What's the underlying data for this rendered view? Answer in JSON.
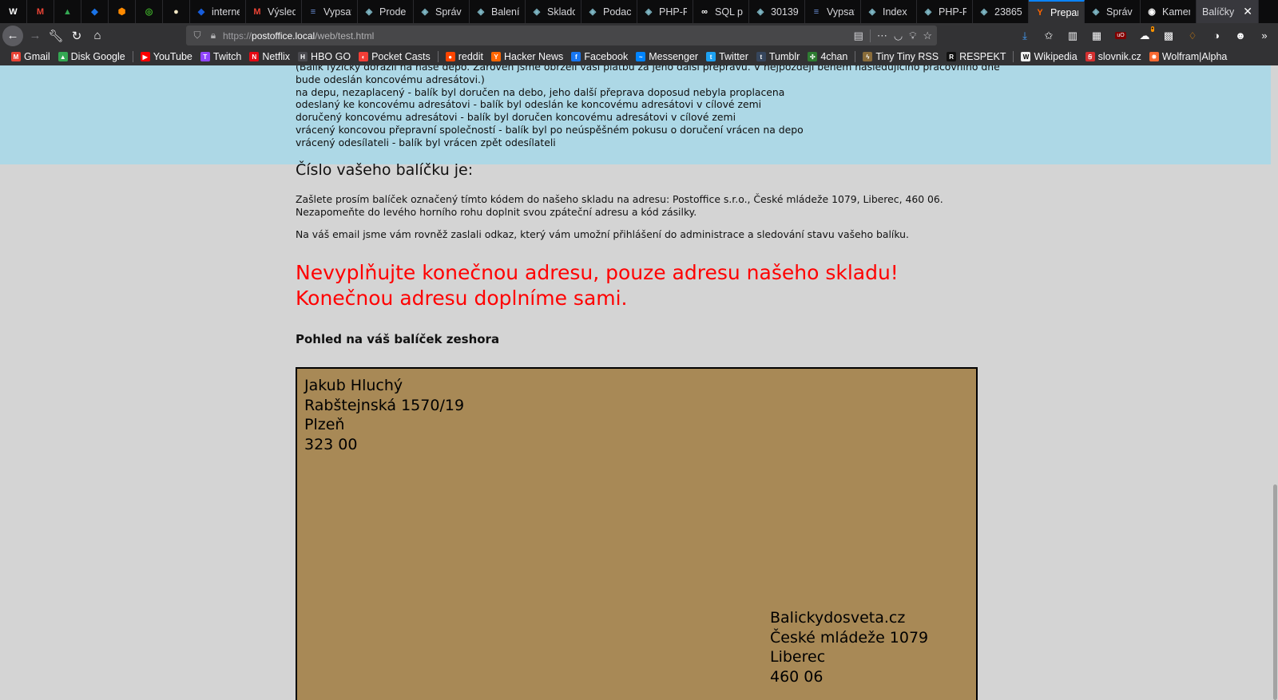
{
  "tabs": [
    {
      "label": "",
      "icon": "w-icon",
      "color": "#ffffff",
      "glyph": "W",
      "compact": true
    },
    {
      "label": "",
      "icon": "gmail-icon",
      "color": "#ea4335",
      "glyph": "M",
      "compact": true
    },
    {
      "label": "",
      "icon": "google-drive-icon",
      "color": "#34a853",
      "glyph": "▲",
      "compact": true
    },
    {
      "label": "",
      "icon": "shield-icon",
      "color": "#1a73e8",
      "glyph": "◆",
      "compact": true
    },
    {
      "label": "",
      "icon": "hexagon-icon",
      "color": "#ff8a00",
      "glyph": "⬢",
      "compact": true
    },
    {
      "label": "",
      "icon": "ring-icon",
      "color": "#3fae29",
      "glyph": "◎",
      "compact": true
    },
    {
      "label": "",
      "icon": "bulb-icon",
      "color": "#f2e7c4",
      "glyph": "●",
      "compact": true
    },
    {
      "label": "interne",
      "icon": "bitwarden-icon",
      "color": "#175ddc",
      "glyph": "◆"
    },
    {
      "label": "Výsled",
      "icon": "gmail-icon",
      "color": "#ea4335",
      "glyph": "M"
    },
    {
      "label": "Vypsat",
      "icon": "database-icon",
      "color": "#6a8fd8",
      "glyph": "≡"
    },
    {
      "label": "Prode",
      "icon": "cube-icon",
      "color": "#7fb8c6",
      "glyph": "◈"
    },
    {
      "label": "Správ",
      "icon": "cube-icon",
      "color": "#7fb8c6",
      "glyph": "◈"
    },
    {
      "label": "Balení",
      "icon": "cube-icon",
      "color": "#7fb8c6",
      "glyph": "◈"
    },
    {
      "label": "Sklado",
      "icon": "cube-icon",
      "color": "#7fb8c6",
      "glyph": "◈"
    },
    {
      "label": "Podac",
      "icon": "cube-icon",
      "color": "#7fb8c6",
      "glyph": "◈"
    },
    {
      "label": "PHP-F",
      "icon": "cube-icon",
      "color": "#7fb8c6",
      "glyph": "◈"
    },
    {
      "label": "SQL p",
      "icon": "sql-icon",
      "color": "#ffffff",
      "glyph": "∞"
    },
    {
      "label": "30139",
      "icon": "cube-icon",
      "color": "#7fb8c6",
      "glyph": "◈"
    },
    {
      "label": "Vypsat",
      "icon": "database-icon",
      "color": "#6a8fd8",
      "glyph": "≡"
    },
    {
      "label": "Index",
      "icon": "cube-icon",
      "color": "#7fb8c6",
      "glyph": "◈"
    },
    {
      "label": "PHP-F",
      "icon": "cube-icon",
      "color": "#7fb8c6",
      "glyph": "◈"
    },
    {
      "label": "23865",
      "icon": "cube-icon",
      "color": "#7fb8c6",
      "glyph": "◈"
    },
    {
      "label": "Prepar",
      "icon": "ycombinator-icon",
      "color": "#ff6600",
      "glyph": "Y",
      "selected": true
    },
    {
      "label": "Správ",
      "icon": "cube-icon",
      "color": "#7fb8c6",
      "glyph": "◈"
    },
    {
      "label": "Kamer",
      "icon": "camera-icon",
      "color": "#ffffff",
      "glyph": "◉"
    },
    {
      "label": "Balíčky",
      "icon": "",
      "color": "",
      "glyph": "",
      "active": true
    }
  ],
  "nav": {
    "url_scheme": "https://",
    "url_host": "postoffice.local",
    "url_path": "/web/test.html"
  },
  "bookmarks": [
    {
      "label": "Gmail",
      "icon": "gmail-icon",
      "color": "#ea4335",
      "glyph": "M"
    },
    {
      "label": "Disk Google",
      "icon": "google-drive-icon",
      "color": "#34a853",
      "glyph": "▲"
    },
    {
      "sep": true
    },
    {
      "label": "YouTube",
      "icon": "youtube-icon",
      "color": "#ff0000",
      "glyph": "▶"
    },
    {
      "label": "Twitch",
      "icon": "twitch-icon",
      "color": "#9146ff",
      "glyph": "T"
    },
    {
      "label": "Netflix",
      "icon": "netflix-icon",
      "color": "#e50914",
      "glyph": "N"
    },
    {
      "label": "HBO GO",
      "icon": "hbo-icon",
      "color": "#4a4a4f",
      "glyph": "H"
    },
    {
      "label": "Pocket Casts",
      "icon": "pocket-casts-icon",
      "color": "#f43e37",
      "glyph": "◐"
    },
    {
      "sep": true
    },
    {
      "label": "reddit",
      "icon": "reddit-icon",
      "color": "#ff4500",
      "glyph": "●"
    },
    {
      "label": "Hacker News",
      "icon": "ycombinator-icon",
      "color": "#ff6600",
      "glyph": "Y"
    },
    {
      "label": "Facebook",
      "icon": "facebook-icon",
      "color": "#1877f2",
      "glyph": "f"
    },
    {
      "label": "Messenger",
      "icon": "messenger-icon",
      "color": "#0084ff",
      "glyph": "~"
    },
    {
      "label": "Twitter",
      "icon": "twitter-icon",
      "color": "#1da1f2",
      "glyph": "t"
    },
    {
      "label": "Tumblr",
      "icon": "tumblr-icon",
      "color": "#36465d",
      "glyph": "t"
    },
    {
      "label": "4chan",
      "icon": "clover-icon",
      "color": "#2e7d32",
      "glyph": "✣"
    },
    {
      "sep": true
    },
    {
      "label": "Tiny Tiny RSS",
      "icon": "rss-icon",
      "color": "#8a6d3b",
      "glyph": "ϟ"
    },
    {
      "label": "RESPEKT",
      "icon": "respekt-icon",
      "color": "#111111",
      "glyph": "R"
    },
    {
      "sep": true
    },
    {
      "label": "Wikipedia",
      "icon": "wikipedia-icon",
      "color": "#eeeeee",
      "glyph": "W"
    },
    {
      "label": "slovnik.cz",
      "icon": "dictionary-icon",
      "color": "#d32f2f",
      "glyph": "Ꞩ"
    },
    {
      "label": "Wolfram|Alpha",
      "icon": "wolfram-icon",
      "color": "#f96932",
      "glyph": "✸"
    }
  ],
  "page": {
    "status_lines": [
      "(Balík fyzicky dorazil na naše depo. Zároveň jsme obrželi vaši platbu za jeho další přepravu. V nejpozději během následujícího pracovního dne",
      "bude odeslán koncovému adresátovi.)",
      "na depu, nezaplacený - balík byl doručen na debo, jeho další přeprava doposud nebyla proplacena",
      "odeslaný ke koncovému adresátovi - balík byl odeslán ke koncovému adresátovi v cílové zemi",
      "doručený koncovému adresátovi - balík byl doručen koncovému adresátovi v cílové zemi",
      "vrácený koncovou přepravní společností - balík byl po neúspěšném pokusu o doručení vrácen na depo",
      "vrácený odesílateli - balík byl vrácen zpět odesílateli"
    ],
    "number_heading": "Číslo vašeho balíčku je:",
    "lead_line1": "Zašlete prosím balíček označený tímto kódem do našeho skladu na adresu: Postoffice s.r.o., České mládeže 1079, Liberec, 460 06.",
    "lead_line2": "Nezapomeňte do levého horního rohu doplnit svou zpáteční adresu a kód zásilky.",
    "email_note": "Na váš email jsme vám rovněž zaslali odkaz, který vám umožní přihlášení do administrace a sledování stavu vašeho balíku.",
    "warning_line1": "Nevyplňujte konečnou adresu, pouze adresu našeho skladu!",
    "warning_line2": "Konečnou adresu doplníme sami.",
    "top_view_heading": "Pohled na váš balíček zeshora",
    "package_color": "#a88956",
    "sender": {
      "name": "Jakub Hluchý",
      "street": "Rabštejnská 1570/19",
      "city": "Plzeň",
      "zip": "323 00"
    },
    "recipient": {
      "name": "Balickydosveta.cz",
      "street": "České mládeže 1079",
      "city": "Liberec",
      "zip": "460 06"
    }
  }
}
